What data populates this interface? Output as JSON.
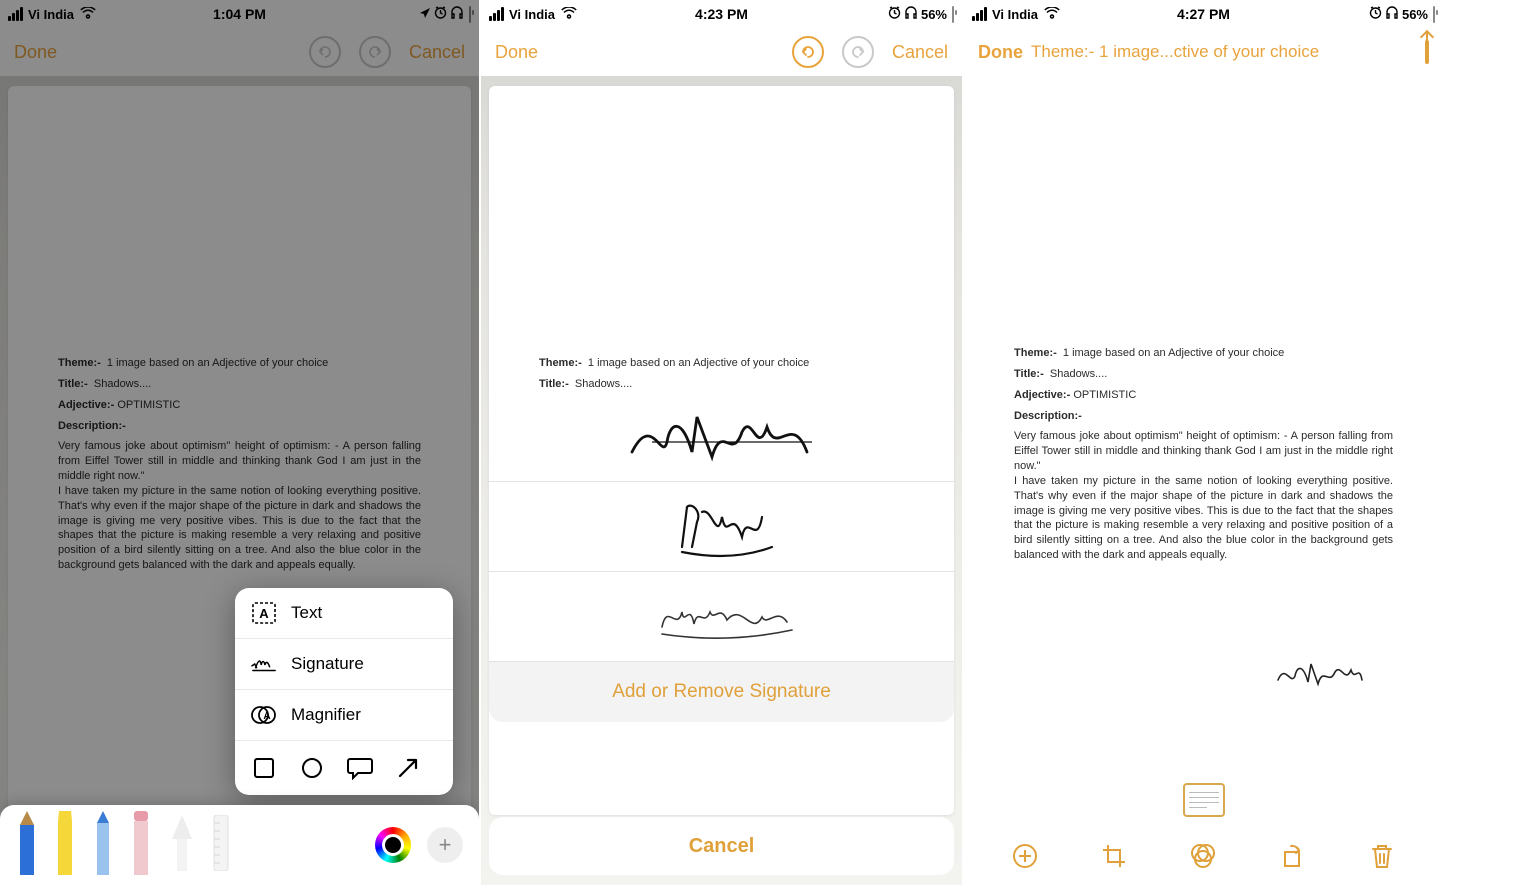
{
  "panel1": {
    "status": {
      "carrier": "Vi India",
      "time": "1:04 PM"
    },
    "nav": {
      "done": "Done",
      "cancel": "Cancel"
    },
    "popup": {
      "text_label": "Text",
      "signature_label": "Signature",
      "magnifier_label": "Magnifier"
    }
  },
  "panel2": {
    "status": {
      "carrier": "Vi India",
      "time": "4:23 PM",
      "battery": "56%"
    },
    "nav": {
      "done": "Done",
      "cancel": "Cancel"
    },
    "sheet": {
      "add_remove_label": "Add or Remove Signature",
      "cancel_label": "Cancel"
    }
  },
  "panel3": {
    "status": {
      "carrier": "Vi India",
      "time": "4:27 PM",
      "battery": "56%"
    },
    "nav": {
      "done": "Done",
      "title": "Theme:- 1 image...ctive of your choice"
    }
  },
  "document": {
    "theme_label": "Theme:-",
    "theme_value": "1 image based on an Adjective of your choice",
    "title_label": "Title:-",
    "title_value": "Shadows....",
    "adjective_label": "Adjective:-",
    "adjective_value": "OPTIMISTIC",
    "description_label": "Description:-",
    "description_body": "Very famous joke about optimism\" height of optimism: - A person falling from Eiffel Tower still in middle and thinking thank God I am just in the middle right now.\"\n I have taken my picture in the same notion of looking everything positive. That's why even if the major shape of the picture in dark and shadows the image is giving me very positive vibes. This is due to the fact that the shapes that the picture is making resemble a very relaxing and positive position of a bird silently sitting on a tree.  And also the blue color in the background gets balanced with the dark and appeals equally."
  }
}
